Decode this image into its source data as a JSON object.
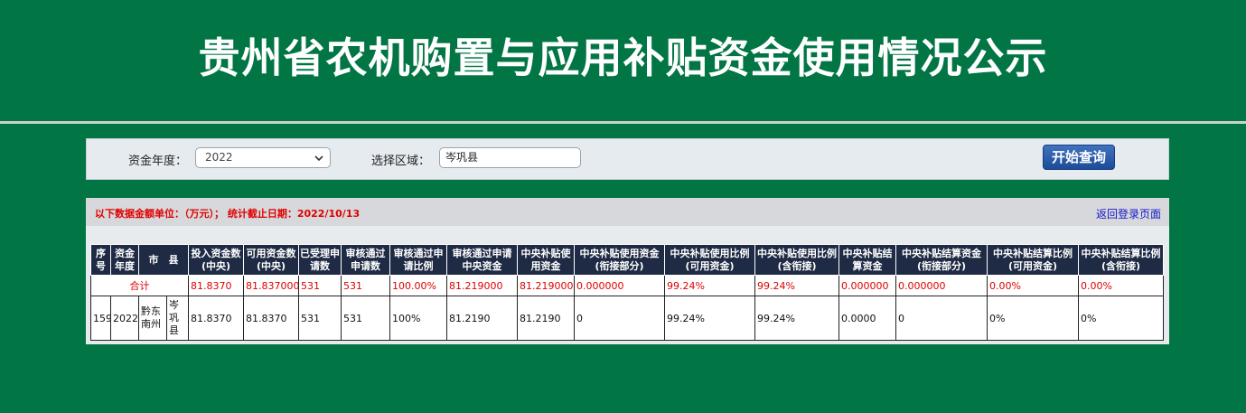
{
  "header": {
    "title": "贵州省农机购置与应用补贴资金使用情况公示"
  },
  "search": {
    "year_label": "资金年度：",
    "year_value": "2022",
    "region_label": "选择区域：",
    "region_value": "岑巩县",
    "query_button": "开始查询"
  },
  "info": {
    "notice": "以下数据金额单位：（万元）；  统计截止日期：2022/10/13",
    "back_link": "返回登录页面"
  },
  "table": {
    "headers": [
      "序号",
      "资金年度",
      "市　县",
      "投入资金数(中央)",
      "可用资金数(中央)",
      "已受理申请数",
      "审核通过申请数",
      "审核通过申请比例",
      "审核通过申请中央资金",
      "中央补贴使用资金",
      "中央补贴使用资金(衔接部分)",
      "中央补贴使用比例(可用资金)",
      "中央补贴使用比例(含衔接)",
      "中央补贴结算资金",
      "中央补贴结算资金(衔接部分)",
      "中央补贴结算比例(可用资金)",
      "中央补贴结算比例(含衔接)"
    ],
    "total_row": {
      "label": "合计",
      "cells": [
        "81.8370",
        "81.837000",
        "531",
        "531",
        "100.00%",
        "81.219000",
        "81.219000",
        "0.000000",
        "99.24%",
        "99.24%",
        "0.000000",
        "0.000000",
        "0.00%",
        "0.00%"
      ]
    },
    "rows": [
      {
        "seq": "159",
        "year": "2022",
        "city": "黔东南州",
        "county": "岑巩县",
        "cells": [
          "81.8370",
          "81.8370",
          "531",
          "531",
          "100%",
          "81.2190",
          "81.2190",
          "0",
          "99.24%",
          "99.24%",
          "0.0000",
          "0",
          "0%",
          "0%"
        ]
      }
    ]
  },
  "colors": {
    "background": "#017544",
    "header_row": "#1f2a44",
    "alert_text": "#e00000",
    "link": "#1616c8"
  }
}
